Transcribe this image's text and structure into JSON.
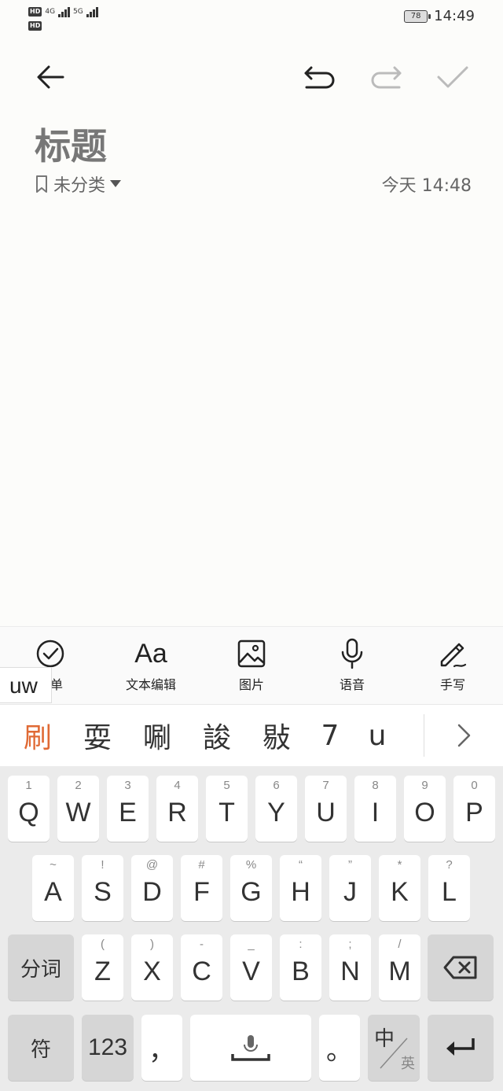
{
  "status": {
    "net1": "4G",
    "net2": "5G",
    "hd": "HD",
    "battery": "78",
    "time": "14:49"
  },
  "note": {
    "title": "标题",
    "category": "未分类",
    "timestamp": "今天 14:48"
  },
  "tools": [
    {
      "label": "清单",
      "icon": "checklist-icon"
    },
    {
      "label": "文本编辑",
      "icon": "text-format-icon",
      "glyph": "Aa"
    },
    {
      "label": "图片",
      "icon": "image-icon"
    },
    {
      "label": "语音",
      "icon": "microphone-icon"
    },
    {
      "label": "手写",
      "icon": "handwriting-icon"
    }
  ],
  "ime": {
    "composing": "uw",
    "candidates": [
      "刷",
      "耍",
      "唰",
      "誜",
      "敡",
      "7",
      "u"
    ],
    "row1": [
      {
        "k": "Q",
        "h": "1"
      },
      {
        "k": "W",
        "h": "2"
      },
      {
        "k": "E",
        "h": "3"
      },
      {
        "k": "R",
        "h": "4"
      },
      {
        "k": "T",
        "h": "5"
      },
      {
        "k": "Y",
        "h": "6"
      },
      {
        "k": "U",
        "h": "7"
      },
      {
        "k": "I",
        "h": "8"
      },
      {
        "k": "O",
        "h": "9"
      },
      {
        "k": "P",
        "h": "0"
      }
    ],
    "row2": [
      {
        "k": "A",
        "h": "~"
      },
      {
        "k": "S",
        "h": "!"
      },
      {
        "k": "D",
        "h": "@"
      },
      {
        "k": "F",
        "h": "#"
      },
      {
        "k": "G",
        "h": "%"
      },
      {
        "k": "H",
        "h": "“"
      },
      {
        "k": "J",
        "h": "”"
      },
      {
        "k": "K",
        "h": "*"
      },
      {
        "k": "L",
        "h": "?"
      }
    ],
    "row3": [
      {
        "k": "Z",
        "h": "("
      },
      {
        "k": "X",
        "h": ")"
      },
      {
        "k": "C",
        "h": "-"
      },
      {
        "k": "V",
        "h": "_"
      },
      {
        "k": "B",
        "h": ":"
      },
      {
        "k": "N",
        "h": ";"
      },
      {
        "k": "M",
        "h": "/"
      }
    ],
    "segment_label": "分词",
    "symbol_label": "符",
    "num_label": "123",
    "comma_label": "，",
    "period_label": "。",
    "lang_main": "中",
    "lang_sub": "英"
  }
}
